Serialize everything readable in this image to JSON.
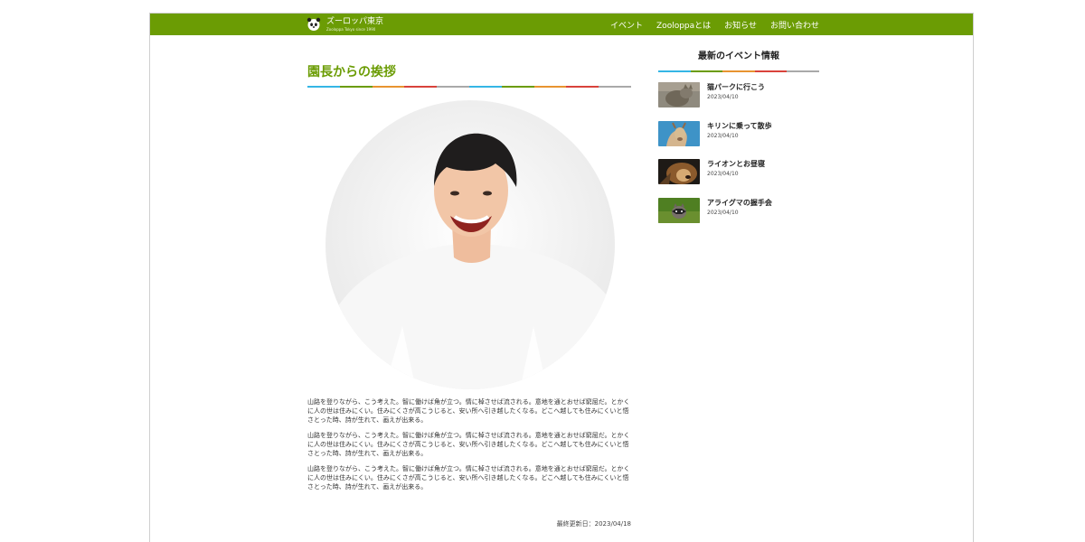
{
  "header": {
    "site_title": "ズーロッパ東京",
    "site_subtitle": "Zooloppa Tokyo since 1990",
    "nav": [
      "イベント",
      "Zooloppaとは",
      "お知らせ",
      "お問い合わせ"
    ],
    "color": "#6b9c04",
    "logo_icon": "panda-icon"
  },
  "main": {
    "title": "園長からの挨拶",
    "paragraphs": [
      "山路を登りながら、こう考えた。智に働けば角が立つ。情に棹させば流される。意地を通とおせば窮屈だ。とかくに人の世は住みにくい。住みにくさが高こうじると、安い所へ引き越したくなる。どこへ越しても住みにくいと悟さとった時、詩が生れて、画えが出来る。",
      "山路を登りながら、こう考えた。智に働けば角が立つ。情に棹させば流される。意地を通とおせば窮屈だ。とかくに人の世は住みにくい。住みにくさが高こうじると、安い所へ引き越したくなる。どこへ越しても住みにくいと悟さとった時、詩が生れて、画えが出来る。",
      "山路を登りながら、こう考えた。智に働けば角が立つ。情に棹させば流される。意地を通とおせば窮屈だ。とかくに人の世は住みにくい。住みにくさが高こうじると、安い所へ引き越したくなる。どこへ越しても住みにくいと悟さとった時、詩が生れて、画えが出来る。"
    ],
    "last_updated": "最終更新日：2023/04/18"
  },
  "sidebar": {
    "title": "最新のイベント情報",
    "events": [
      {
        "title": "猫パークに行こう",
        "date": "2023/04/10",
        "thumb_icon": "cat-photo"
      },
      {
        "title": "キリンに乗って散歩",
        "date": "2023/04/10",
        "thumb_icon": "giraffe-photo"
      },
      {
        "title": "ライオンとお昼寝",
        "date": "2023/04/10",
        "thumb_icon": "lion-photo"
      },
      {
        "title": "アライグマの握手会",
        "date": "2023/04/10",
        "thumb_icon": "raccoon-photo"
      }
    ]
  },
  "rule_colors": [
    "#35b6e5",
    "#6b9c04",
    "#e89430",
    "#d9423b",
    "#a9a9a9"
  ]
}
